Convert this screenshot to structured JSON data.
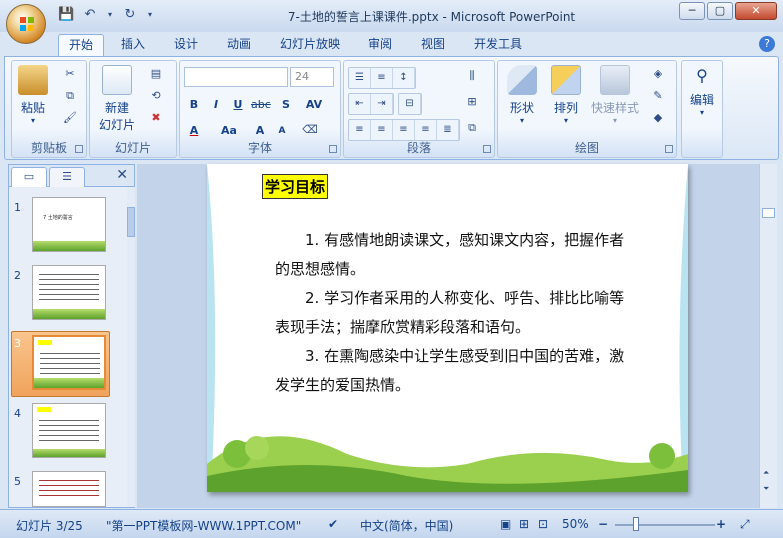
{
  "window": {
    "title": "7-土地的誓言上课课件.pptx - Microsoft PowerPoint",
    "minimize": "─",
    "maximize": "▢",
    "close": "✕"
  },
  "qat": {
    "save_icon": "save-icon",
    "undo_icon": "undo-icon",
    "redo_icon": "redo-icon",
    "customize_icon": "customize-qat-icon"
  },
  "tabs": [
    "开始",
    "插入",
    "设计",
    "动画",
    "幻灯片放映",
    "审阅",
    "视图",
    "开发工具"
  ],
  "help": "?",
  "ribbon": {
    "clipboard": {
      "label": "剪贴板",
      "paste": "粘贴"
    },
    "slides": {
      "label": "幻灯片",
      "new_slide_line1": "新建",
      "new_slide_line2": "幻灯片"
    },
    "font": {
      "label": "字体",
      "font_name": "",
      "font_size": "24",
      "bold": "B",
      "italic": "I",
      "underline": "U",
      "strike": "abc",
      "shadow": "S",
      "spacing": "AV",
      "case": "Aa",
      "grow": "A",
      "shrink": "A",
      "color": "A"
    },
    "paragraph": {
      "label": "段落"
    },
    "drawing": {
      "label": "绘图",
      "shapes": "形状",
      "arrange": "排列",
      "quick_styles": "快速样式"
    },
    "editing": {
      "label": "编辑"
    }
  },
  "thumbnails": [
    {
      "num": "1",
      "text": "7  土地的誓言"
    },
    {
      "num": "2",
      "text": ""
    },
    {
      "num": "3",
      "text": ""
    },
    {
      "num": "4",
      "text": ""
    },
    {
      "num": "5",
      "text": ""
    }
  ],
  "slide": {
    "heading": "学习目标",
    "p1": "1. 有感情地朗读课文，感知课文内容，把握作者的思想感情。",
    "p2": "2. 学习作者采用的人称变化、呼告、排比比喻等表现手法；揣摩欣赏精彩段落和语句。",
    "p3": "3. 在熏陶感染中让学生感受到旧中国的苦难，激发学生的爱国热情。"
  },
  "status": {
    "slide_info": "幻灯片 3/25",
    "theme": "\"第一PPT模板网-WWW.1PPT.COM\"",
    "language": "中文(简体，中国)",
    "zoom": "50%",
    "minus": "−",
    "plus": "+"
  },
  "colors": {
    "accent": "#15428b",
    "selected_thumb": "#f0a35c",
    "heading_bg": "#ffff00"
  }
}
